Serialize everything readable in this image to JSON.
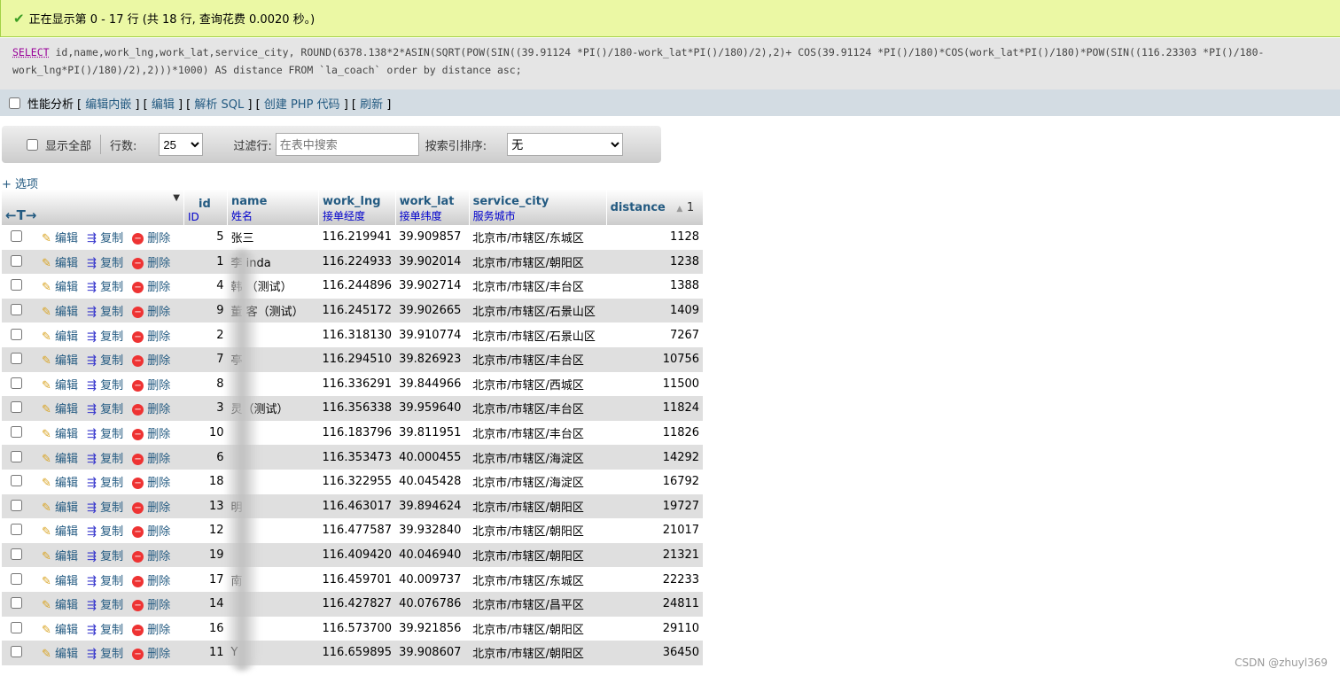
{
  "status": {
    "message": "正在显示第 0 - 17 行 (共 18 行, 查询花费 0.0020 秒。)"
  },
  "sql": {
    "line1_select": "SELECT",
    "line1_rest": " id,name,work_lng,work_lat,service_city, ROUND(6378.138*2*ASIN(SQRT(POW(SIN((39.91124 *PI()/180-work_lat*PI()/180)/2),2)+ COS(39.91124 *PI()/180)*COS(work_lat*PI()/180)*POW(SIN((116.23303 *PI()/180-",
    "line2": "work_lng*PI()/180)/2),2)))*1000) AS distance FROM `la_coach` order by distance asc;"
  },
  "tools": {
    "profiling": "性能分析",
    "links": [
      "编辑内嵌",
      "编辑",
      "解析 SQL",
      "创建 PHP 代码",
      "刷新"
    ]
  },
  "nav": {
    "show_all": "显示全部",
    "rows_label": "行数:",
    "rows_value": "25",
    "filter_label": "过滤行:",
    "filter_placeholder": "在表中搜索",
    "sort_label": "按索引排序:",
    "sort_value": "无"
  },
  "options_link": "+ 选项",
  "columns": [
    {
      "name": "id",
      "comment": "ID"
    },
    {
      "name": "name",
      "comment": "姓名"
    },
    {
      "name": "work_lng",
      "comment": "接单经度"
    },
    {
      "name": "work_lat",
      "comment": "接单纬度"
    },
    {
      "name": "service_city",
      "comment": "服务城市"
    },
    {
      "name": "distance",
      "comment": "",
      "sort": "1"
    }
  ],
  "actions": {
    "edit": "编辑",
    "copy": "复制",
    "delete": "删除"
  },
  "rows": [
    [
      "5",
      "张三",
      "116.219941",
      "39.909857",
      "北京市/市辖区/东城区",
      "1128"
    ],
    [
      "1",
      "李    inda",
      "116.224933",
      "39.902014",
      "北京市/市辖区/朝阳区",
      "1238"
    ],
    [
      "4",
      "韩    （测试）",
      "116.244896",
      "39.902714",
      "北京市/市辖区/丰台区",
      "1388"
    ],
    [
      "9",
      "董    客（测试）",
      "116.245172",
      "39.902665",
      "北京市/市辖区/石景山区",
      "1409"
    ],
    [
      "2",
      "",
      "116.318130",
      "39.910774",
      "北京市/市辖区/石景山区",
      "7267"
    ],
    [
      "7",
      "    亭",
      "116.294510",
      "39.826923",
      "北京市/市辖区/丰台区",
      "10756"
    ],
    [
      "8",
      "",
      "116.336291",
      "39.844966",
      "北京市/市辖区/西城区",
      "11500"
    ],
    [
      "3",
      "    灵（测试）",
      "116.356338",
      "39.959640",
      "北京市/市辖区/丰台区",
      "11824"
    ],
    [
      "10",
      "",
      "116.183796",
      "39.811951",
      "北京市/市辖区/丰台区",
      "11826"
    ],
    [
      "6",
      "",
      "116.353473",
      "40.000455",
      "北京市/市辖区/海淀区",
      "14292"
    ],
    [
      "18",
      "",
      "116.322955",
      "40.045428",
      "北京市/市辖区/海淀区",
      "16792"
    ],
    [
      "13",
      "    明",
      "116.463017",
      "39.894624",
      "北京市/市辖区/朝阳区",
      "19727"
    ],
    [
      "12",
      "",
      "116.477587",
      "39.932840",
      "北京市/市辖区/朝阳区",
      "21017"
    ],
    [
      "19",
      "",
      "116.409420",
      "40.046940",
      "北京市/市辖区/朝阳区",
      "21321"
    ],
    [
      "17",
      "    南",
      "116.459701",
      "40.009737",
      "北京市/市辖区/东城区",
      "22233"
    ],
    [
      "14",
      "",
      "116.427827",
      "40.076786",
      "北京市/市辖区/昌平区",
      "24811"
    ],
    [
      "16",
      "",
      "116.573700",
      "39.921856",
      "北京市/市辖区/朝阳区",
      "29110"
    ],
    [
      "11",
      "Y",
      "116.659895",
      "39.908607",
      "北京市/市辖区/朝阳区",
      "36450"
    ]
  ],
  "watermark": "CSDN @zhuyl369"
}
